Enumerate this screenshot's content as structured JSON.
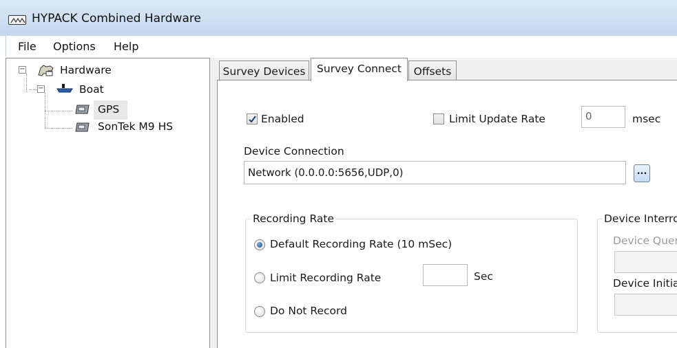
{
  "window": {
    "title": "HYPACK Combined Hardware",
    "icon": "hypack-app-icon"
  },
  "menu": {
    "items": [
      "File",
      "Options",
      "Help"
    ]
  },
  "tree": {
    "root": {
      "label": "Hardware",
      "icon": "hardware-dog-icon",
      "expander": "⊟"
    },
    "boat": {
      "label": "Boat",
      "icon": "boat-icon",
      "expander": "⊟"
    },
    "devices": [
      {
        "label": "GPS",
        "icon": "device-icon",
        "selected": true
      },
      {
        "label": "SonTek M9 HS",
        "icon": "device-icon",
        "selected": false
      }
    ]
  },
  "tabs": [
    {
      "label": "Survey Devices",
      "active": false
    },
    {
      "label": "Survey Connect",
      "active": true
    },
    {
      "label": "Offsets",
      "active": false
    }
  ],
  "survey_connect": {
    "enabled_label": "Enabled",
    "enabled_checked": true,
    "limit_update_rate_label": "Limit Update Rate",
    "limit_update_rate_checked": false,
    "update_rate_value": "0",
    "update_rate_unit": "msec",
    "device_connection_label": "Device Connection",
    "device_connection_value": "Network (0.0.0.0:5656,UDP,0)",
    "browse_label": "...",
    "recording_rate": {
      "title": "Recording Rate",
      "options": [
        {
          "label": "Default Recording Rate (10 mSec)",
          "selected": true
        },
        {
          "label": "Limit Recording Rate",
          "selected": false
        },
        {
          "label": "Do Not Record",
          "selected": false
        }
      ],
      "limit_value": "",
      "limit_unit": "Sec"
    },
    "device_interrogation": {
      "title": "Device Interro",
      "query_label": "Device Quer",
      "query_value": "",
      "init_label": "Device Initial",
      "init_value": ""
    }
  },
  "colors": {
    "titlebar": "#cfe0f2",
    "panel_bg": "#f0f0f0",
    "border": "#8e8f8f",
    "radio_dot": "#1d4f8c"
  }
}
